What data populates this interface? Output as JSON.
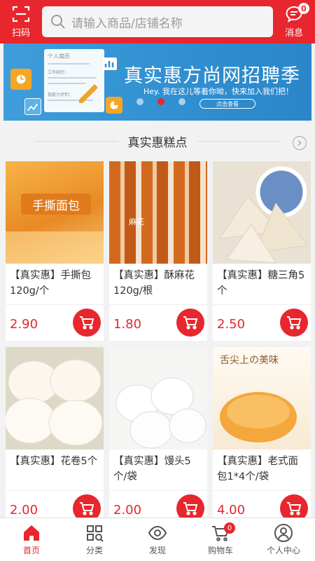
{
  "header": {
    "scan_label": "扫码",
    "search_placeholder": "请输入商品/店铺名称",
    "message_label": "消息",
    "message_count": "0"
  },
  "banner": {
    "title": "真实惠方尚网招聘季",
    "subtitle": "Hey. 我在这儿等着你呦，快来加入我们把！",
    "button_label": "点击查看",
    "doc_title": "个人简历",
    "doc_line1": "工作经历：",
    "doc_line2": "我能力评判：",
    "active_dot": 1,
    "dot_count": 3
  },
  "section": {
    "title": "真实惠糕点"
  },
  "products": [
    {
      "name": "【真实惠】手撕包120g/个",
      "price": "2.90",
      "image_text": "手撕面包"
    },
    {
      "name": "【真实惠】酥麻花120g/根",
      "price": "1.80",
      "image_text": "麻花"
    },
    {
      "name": "【真实惠】糖三角5个",
      "price": "2.50",
      "image_text": ""
    },
    {
      "name": "【真实惠】花卷5个",
      "price": "2.00",
      "image_text": ""
    },
    {
      "name": "【真实惠】馒头5个/袋",
      "price": "2.00",
      "image_text": ""
    },
    {
      "name": "【真实惠】老式面包1*4个/袋",
      "price": "4.00",
      "image_text": "舌尖上の美味"
    }
  ],
  "nav": {
    "items": [
      {
        "label": "首页",
        "icon": "home-icon",
        "active": true
      },
      {
        "label": "分类",
        "icon": "category-icon",
        "active": false
      },
      {
        "label": "发现",
        "icon": "eye-icon",
        "active": false
      },
      {
        "label": "购物车",
        "icon": "cart-icon",
        "active": false
      },
      {
        "label": "个人中心",
        "icon": "user-icon",
        "active": false
      }
    ],
    "cart_count": "0"
  },
  "colors": {
    "brand_red": "#e8262e",
    "banner_blue": "#3f9ddb"
  }
}
